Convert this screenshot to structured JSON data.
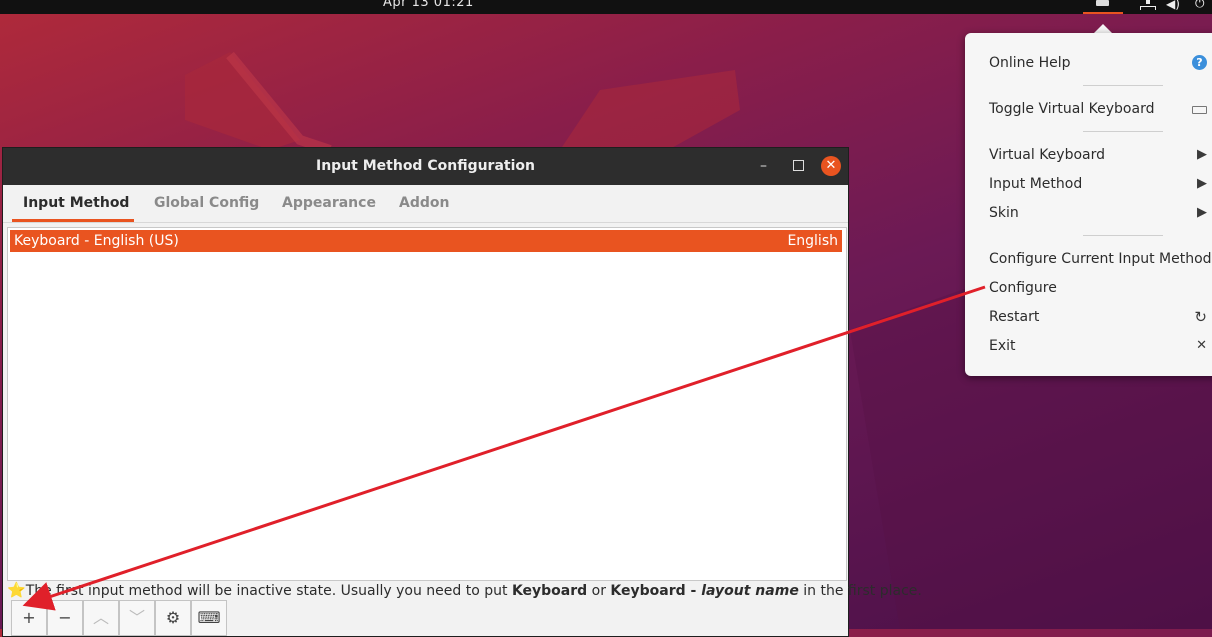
{
  "topbar": {
    "clock": "Apr 13  01:21",
    "icons": [
      "keyboard-icon",
      "network-icon",
      "volume-icon",
      "power-icon"
    ]
  },
  "menu": {
    "items": [
      {
        "label": "Online Help",
        "icon": "help-icon"
      },
      {
        "label": "Toggle Virtual Keyboard",
        "icon": "keyboard-icon"
      },
      {
        "label": "Virtual Keyboard",
        "icon": "submenu-arrow-icon"
      },
      {
        "label": "Input Method",
        "icon": "submenu-arrow-icon"
      },
      {
        "label": "Skin",
        "icon": "submenu-arrow-icon"
      },
      {
        "label": "Configure Current Input Method"
      },
      {
        "label": "Configure"
      },
      {
        "label": "Restart",
        "icon": "restart-icon"
      },
      {
        "label": "Exit",
        "icon": "close-icon"
      }
    ]
  },
  "window": {
    "title": "Input Method Configuration",
    "tabs": [
      "Input Method",
      "Global Config",
      "Appearance",
      "Addon"
    ],
    "active_tab": "Input Method",
    "list": [
      {
        "name": "Keyboard - English (US)",
        "language": "English",
        "selected": true
      }
    ],
    "hint": {
      "part1": "The first input method will be inactive state. Usually you need to put ",
      "bold1": "Keyboard",
      "part2": " or ",
      "bold2": "Keyboard - ",
      "italic": "layout name",
      "part3": " in the first place."
    },
    "toolbar": [
      {
        "icon": "add-icon",
        "glyph": "+"
      },
      {
        "icon": "remove-icon",
        "glyph": "−"
      },
      {
        "icon": "move-up-icon",
        "glyph": "︿"
      },
      {
        "icon": "move-down-icon",
        "glyph": "﹀"
      },
      {
        "icon": "configure-icon",
        "glyph": "⚙"
      },
      {
        "icon": "keyboard-layout-icon",
        "glyph": "⌨"
      }
    ]
  },
  "colors": {
    "accent": "#e95420",
    "annotation_arrow": "#e0202a"
  }
}
